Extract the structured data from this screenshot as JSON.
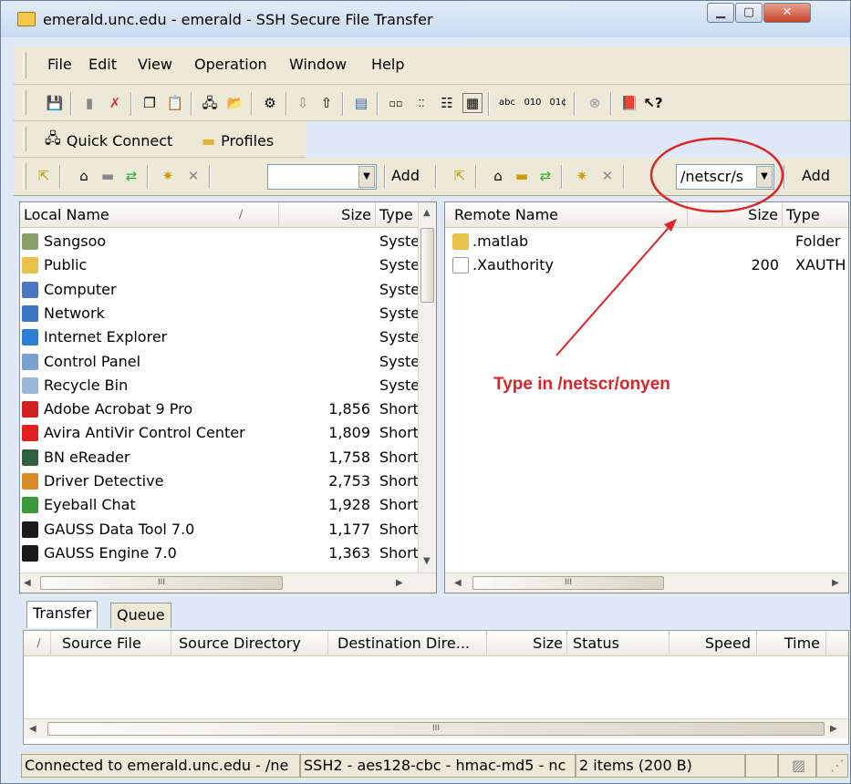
{
  "window": {
    "title": "emerald.unc.edu - emerald - SSH Secure File Transfer",
    "controls": [
      "minimize",
      "maximize",
      "close"
    ]
  },
  "menu": [
    "File",
    "Edit",
    "View",
    "Operation",
    "Window",
    "Help"
  ],
  "toolbar1_icons": [
    "save-icon",
    "print-icon",
    "delete-icon",
    "copy-icon",
    "paste-icon",
    "new-connection-icon",
    "new-window-icon",
    "settings-icon",
    "download-icon",
    "upload-icon",
    "terminal-icon",
    "view-large-icon",
    "view-small-icon",
    "view-list-icon",
    "view-details-icon",
    "ascii-icon",
    "binary-icon",
    "auto-icon",
    "disconnect-icon",
    "help-book-icon",
    "what-is-this-icon"
  ],
  "toolbar2": {
    "quick_connect": "Quick Connect",
    "profiles": "Profiles"
  },
  "local": {
    "path_value": "",
    "add": "Add",
    "columns": {
      "name": "Local Name",
      "sort_mark": "/",
      "size": "Size",
      "type": "Type"
    },
    "rows": [
      {
        "name": "Sangsoo",
        "size": "",
        "type": "Syster",
        "icon": "user-folder-icon",
        "color": "#8aa06a"
      },
      {
        "name": "Public",
        "size": "",
        "type": "Syster",
        "icon": "folder-icon",
        "color": "#e8c14a"
      },
      {
        "name": "Computer",
        "size": "",
        "type": "Syster",
        "icon": "computer-icon",
        "color": "#4a78c0"
      },
      {
        "name": "Network",
        "size": "",
        "type": "Syster",
        "icon": "network-icon",
        "color": "#3a74c4"
      },
      {
        "name": "Internet Explorer",
        "size": "",
        "type": "Syster",
        "icon": "ie-icon",
        "color": "#2d7fd3"
      },
      {
        "name": "Control Panel",
        "size": "",
        "type": "Syster",
        "icon": "control-panel-icon",
        "color": "#7aa0d0"
      },
      {
        "name": "Recycle Bin",
        "size": "",
        "type": "Syster",
        "icon": "recycle-bin-icon",
        "color": "#9cb7d8"
      },
      {
        "name": "Adobe Acrobat 9 Pro",
        "size": "1,856",
        "type": "Shortc",
        "icon": "acrobat-icon",
        "color": "#d02020"
      },
      {
        "name": "Avira AntiVir Control Center",
        "size": "1,809",
        "type": "Shortc",
        "icon": "avira-icon",
        "color": "#e02020"
      },
      {
        "name": "BN eReader",
        "size": "1,758",
        "type": "Shortc",
        "icon": "bn-ereader-icon",
        "color": "#2f5f3f"
      },
      {
        "name": "Driver Detective",
        "size": "2,753",
        "type": "Shortc",
        "icon": "driver-detective-icon",
        "color": "#d98a2a"
      },
      {
        "name": "Eyeball Chat",
        "size": "1,928",
        "type": "Shortc",
        "icon": "eyeball-chat-icon",
        "color": "#3a9a3a"
      },
      {
        "name": "GAUSS Data Tool 7.0",
        "size": "1,177",
        "type": "Shortc",
        "icon": "gauss-icon",
        "color": "#1a1a1a"
      },
      {
        "name": "GAUSS Engine 7.0",
        "size": "1,363",
        "type": "Shortc",
        "icon": "gauss-icon",
        "color": "#1a1a1a"
      }
    ],
    "hscroll_grip": "III"
  },
  "remote": {
    "path_value": "/netscr/s",
    "add": "Add",
    "columns": {
      "name": "Remote Name",
      "size": "Size",
      "type": "Type"
    },
    "rows": [
      {
        "name": ".matlab",
        "size": "",
        "type": "Folder",
        "icon": "folder-icon",
        "color": "#e8c14a"
      },
      {
        "name": ".Xauthority",
        "size": "200",
        "type": "XAUTH",
        "icon": "file-icon",
        "color": "#ffffff"
      }
    ],
    "hscroll_grip": "III"
  },
  "annotation": {
    "text": "Type in /netscr/onyen",
    "color": "#d9262a"
  },
  "transfer": {
    "tabs": [
      "Transfer",
      "Queue"
    ],
    "columns": {
      "sort_mark": "/",
      "source_file": "Source File",
      "source_dir": "Source Directory",
      "dest_dir": "Destination Dire...",
      "size": "Size",
      "status": "Status",
      "speed": "Speed",
      "time": "Time"
    },
    "hscroll_grip": "III"
  },
  "status": {
    "connection": "Connected to emerald.unc.edu - /ne",
    "cipher": "SSH2 - aes128-cbc - hmac-md5 - nc",
    "items": "2 items (200 B)"
  }
}
